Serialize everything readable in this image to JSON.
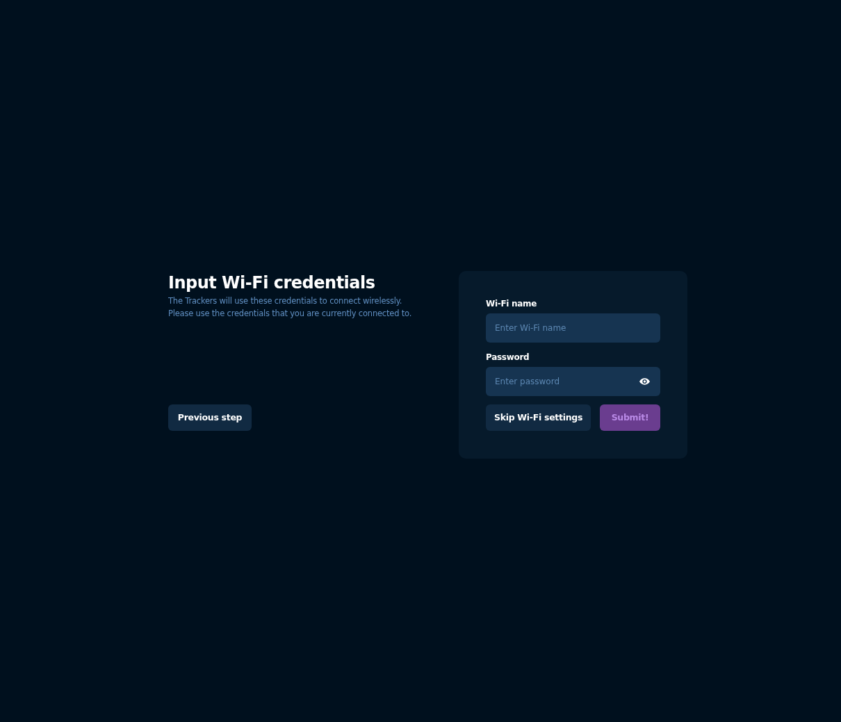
{
  "heading": {
    "title": "Input Wi-Fi credentials",
    "lines": [
      "The Trackers will use these credentials to connect wirelessly.",
      "Please use the credentials that you are currently connected to."
    ]
  },
  "previous_button": {
    "label": "Previous step"
  },
  "form": {
    "fields": [
      {
        "label": "Wi-Fi name",
        "placeholder": "Enter Wi-Fi name",
        "kind": "text"
      },
      {
        "label": "Password",
        "placeholder": "Enter password",
        "kind": "password"
      }
    ],
    "buttons": [
      {
        "label": "Skip Wi-Fi settings",
        "kind": "secondary",
        "disabled": false
      },
      {
        "label": "Submit!",
        "kind": "primary",
        "disabled": true
      }
    ]
  }
}
